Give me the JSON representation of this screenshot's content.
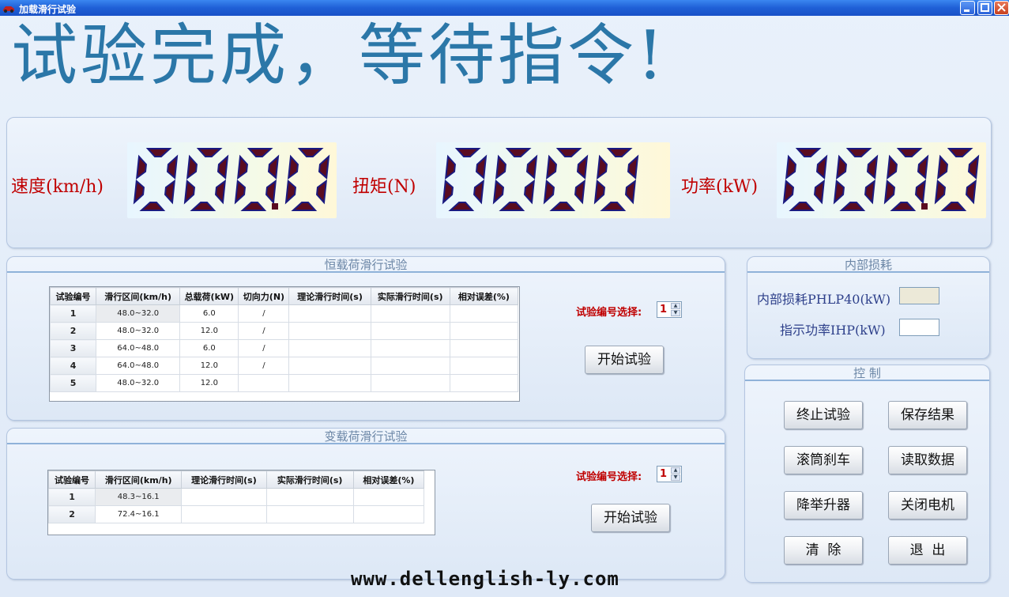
{
  "window": {
    "title": "加载滑行试验"
  },
  "status_message": "试验完成，等待指令!",
  "meters": [
    {
      "label": "速度(km/h)",
      "value": "000.0"
    },
    {
      "label": "扭矩(N)",
      "value": "0000"
    },
    {
      "label": "功率(kW)",
      "value": "000.0"
    }
  ],
  "constant_load": {
    "title": "恒载荷滑行试验",
    "columns": [
      "试验编号",
      "滑行区间(km/h)",
      "总载荷(kW)",
      "切向力(N)",
      "理论滑行时间(s)",
      "实际滑行时间(s)",
      "相对误差(%)"
    ],
    "rows": [
      [
        "1",
        "48.0~32.0",
        "6.0",
        "/",
        "",
        "",
        ""
      ],
      [
        "2",
        "48.0~32.0",
        "12.0",
        "/",
        "",
        "",
        ""
      ],
      [
        "3",
        "64.0~48.0",
        "6.0",
        "/",
        "",
        "",
        ""
      ],
      [
        "4",
        "64.0~48.0",
        "12.0",
        "/",
        "",
        "",
        ""
      ],
      [
        "5",
        "48.0~32.0",
        "12.0",
        "",
        "",
        "",
        ""
      ]
    ],
    "select_label": "试验编号选择:",
    "select_value": "1",
    "start_button": "开始试验"
  },
  "variable_load": {
    "title": "变载荷滑行试验",
    "columns": [
      "试验编号",
      "滑行区间(km/h)",
      "理论滑行时间(s)",
      "实际滑行时间(s)",
      "相对误差(%)"
    ],
    "rows": [
      [
        "1",
        "48.3~16.1",
        "",
        "",
        ""
      ],
      [
        "2",
        "72.4~16.1",
        "",
        "",
        ""
      ]
    ],
    "select_label": "试验编号选择:",
    "select_value": "1",
    "start_button": "开始试验"
  },
  "internal_loss": {
    "title": "内部损耗",
    "phlp_label": "内部损耗PHLP40(kW)",
    "phlp_value": "",
    "ihp_label": "指示功率IHP(kW)",
    "ihp_value": ""
  },
  "control": {
    "title": "控  制",
    "buttons": {
      "stop": "终止试验",
      "save": "保存结果",
      "brake": "滚筒刹车",
      "read": "读取数据",
      "lift": "降举升器",
      "motor_off": "关闭电机",
      "clear": "清  除",
      "exit": "退  出"
    }
  },
  "watermark": "www.dellenglish-ly.com",
  "colors": {
    "status_text": "#2b77a8",
    "meter_label": "#c00000",
    "segment_on": "#5a0c20",
    "segment_edge": "#1a1a80"
  }
}
